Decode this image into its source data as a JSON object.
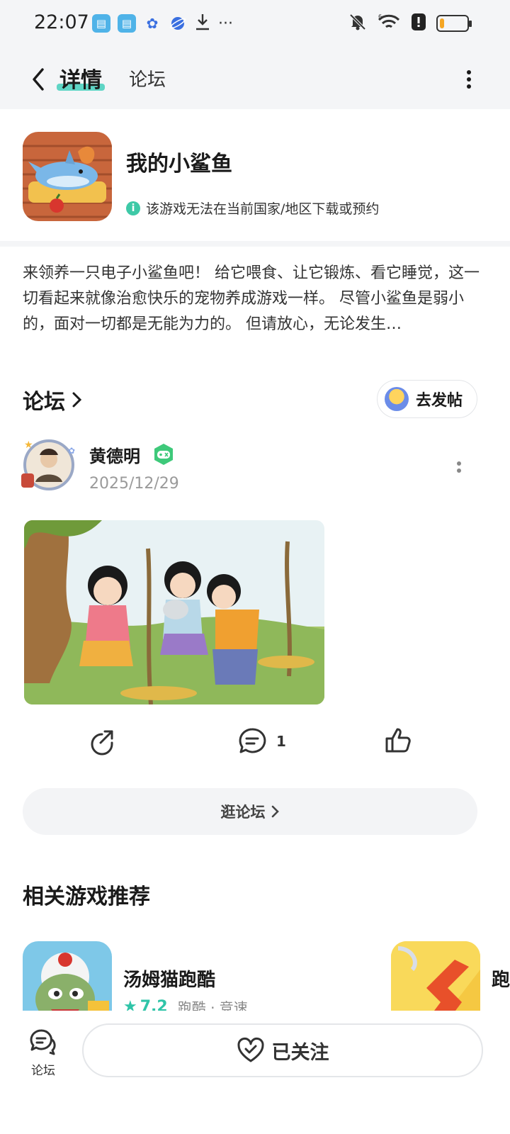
{
  "status_bar": {
    "time": "22:07",
    "battery_level": 0.18
  },
  "nav": {
    "tab_detail": "详情",
    "tab_forum": "论坛"
  },
  "game": {
    "title": "我的小鲨鱼",
    "notice": "该游戏无法在当前国家/地区下载或预约",
    "description": "来领养一只电子小鲨鱼吧！ 给它喂食、让它锻炼、看它睡觉，这一切看起来就像治愈快乐的宠物养成游戏一样。 尽管小鲨鱼是弱小的，面对一切都是无能为力的。 但请放心，无论发生…"
  },
  "forum": {
    "title": "论坛",
    "post_button": "去发帖",
    "post": {
      "author": "黄德明",
      "date": "2025/12/29",
      "comment_count": "1"
    },
    "browse_button": "逛论坛"
  },
  "recommendations": {
    "title": "相关游戏推荐",
    "items": [
      {
        "name": "汤姆猫跑酷",
        "rating": "7.2",
        "tags": "跑酷 · 竞速"
      },
      {
        "name": "跑"
      }
    ]
  },
  "bottom_bar": {
    "forum_label": "论坛",
    "follow_label": "已关注"
  },
  "colors": {
    "accent": "#4fd1bf",
    "rating": "#2fc4a8",
    "battery": "#f5a623"
  }
}
